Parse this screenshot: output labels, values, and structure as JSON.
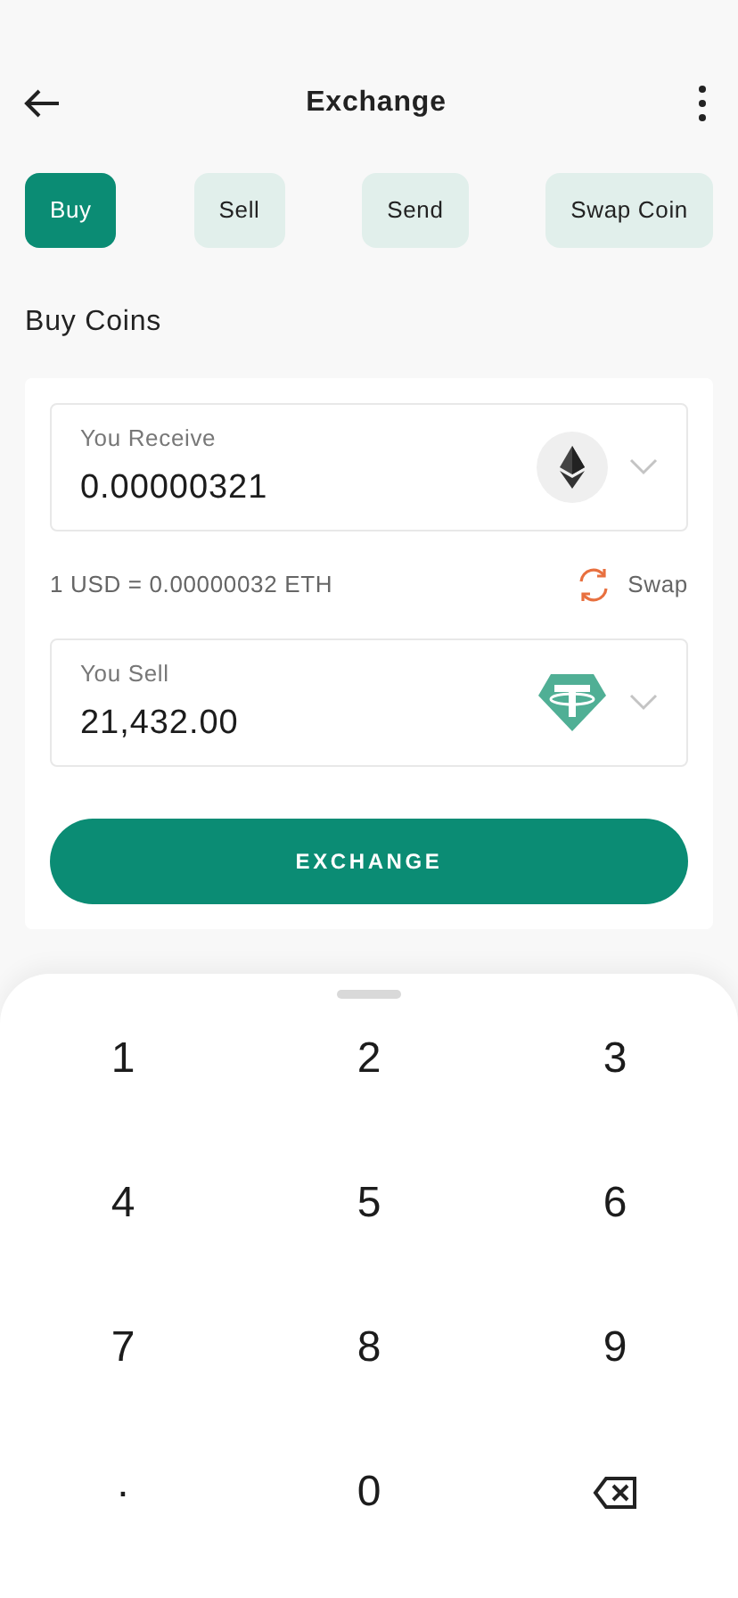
{
  "header": {
    "title": "Exchange"
  },
  "tabs": [
    {
      "label": "Buy",
      "selected": true
    },
    {
      "label": "Sell",
      "selected": false
    },
    {
      "label": "Send",
      "selected": false
    },
    {
      "label": "Swap Coin",
      "selected": false
    }
  ],
  "section_title": "Buy Coins",
  "receive": {
    "label": "You Receive",
    "value": "0.00000321",
    "kind": "eth"
  },
  "rate": {
    "text": "1 USD = 0.00000032 ETH",
    "swap_label": "Swap"
  },
  "sell": {
    "label": "You Sell",
    "value": "21,432.00",
    "kind": "usdt"
  },
  "exchange_button": "EXCHANGE",
  "keypad": [
    {
      "kind": "digit",
      "label": "1"
    },
    {
      "kind": "digit",
      "label": "2"
    },
    {
      "kind": "digit",
      "label": "3"
    },
    {
      "kind": "digit",
      "label": "4"
    },
    {
      "kind": "digit",
      "label": "5"
    },
    {
      "kind": "digit",
      "label": "6"
    },
    {
      "kind": "digit",
      "label": "7"
    },
    {
      "kind": "digit",
      "label": "8"
    },
    {
      "kind": "digit",
      "label": "9"
    },
    {
      "kind": "decimal",
      "label": "."
    },
    {
      "kind": "digit",
      "label": "0"
    },
    {
      "kind": "backspace"
    }
  ]
}
